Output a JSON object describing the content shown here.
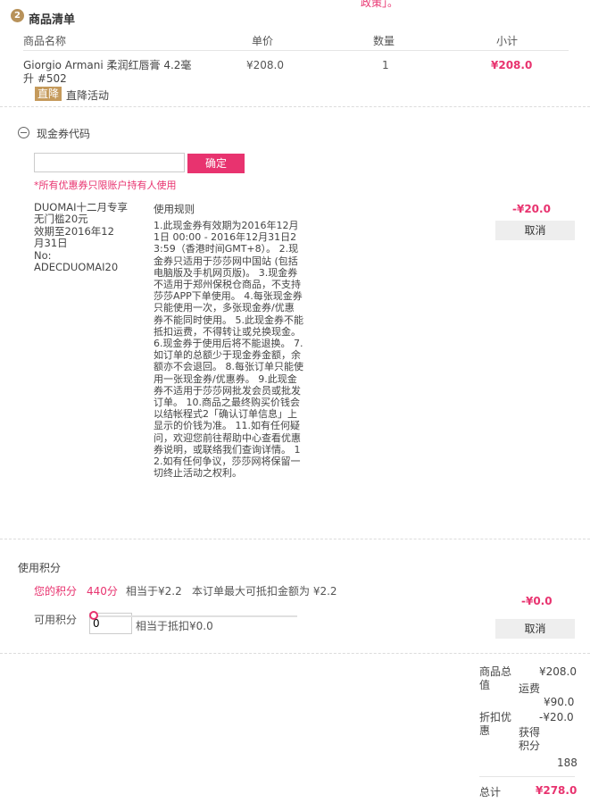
{
  "top_link": "政策」。",
  "section": {
    "step": "2",
    "title": "商品清单"
  },
  "table": {
    "headers": [
      "商品名称",
      "单价",
      "数量",
      "小计"
    ],
    "item": {
      "name": "Giorgio Armani 柔润红唇膏 4.2毫升 #502",
      "price": "¥208.0",
      "qty": "1",
      "subtotal": "¥208.0",
      "promo_tag": "直降",
      "promo_text": "直降活动"
    }
  },
  "coupon": {
    "title": "现金券代码",
    "input_value": "",
    "confirm_label": "确定",
    "warning": "*所有优惠券只限账户持有人使用",
    "name": "DUOMAI十二月专享 无门槛20元",
    "validity": "效期至2016年12月31日",
    "no_label": "No:",
    "code": "ADECDUOMAI20",
    "rules_title": "使用规则",
    "rules_text": "1.此现金券有效期为2016年12月1日 00:00 - 2016年12月31日23:59（香港时间GMT+8）。 2.现金券只适用于莎莎网中国站 (包括电脑版及手机网页版)。 3.现金券不适用于郑州保税仓商品，不支持莎莎APP下单使用。 4.每张现金券只能使用一次，多张现金券/优惠券不能同时使用。 5.此现金券不能抵扣运费，不得转让或兑换现金。 6.现金券于使用后将不能退换。 7.如订单的总额少于现金券金额，余额亦不会退回。 8.每张订单只能使用一张现金券/优惠券。 9.此现金券不适用于莎莎网批发会员或批发订单。 10.商品之最终购买价钱会以结帐程式2「确认订单信息」上显示的价钱为准。 11.如有任何疑问，欢迎您前往帮助中心查看优惠券说明，或联络我们查询详情。 12.如有任何争议，莎莎网将保留一切终止活动之权利。",
    "discount": "-¥20.0",
    "cancel_label": "取消"
  },
  "points": {
    "title": "使用积分",
    "your_points_label": "您的积分",
    "your_points_value": "440分",
    "equivalent": "相当于¥2.2",
    "max_deduct": "本订单最大可抵扣金额为 ¥2.2",
    "usable_label": "可用积分",
    "input_value": "0",
    "slider_fraction": 0,
    "deduct_text": "相当于抵扣¥0.0",
    "discount": "-¥0.0",
    "cancel_label": "取消"
  },
  "summary": {
    "goods_total_label": "商品总值",
    "goods_total": "¥208.0",
    "shipping_label": "运费",
    "shipping": "¥90.0",
    "discount_label": "折扣优惠",
    "discount": "-¥20.0",
    "points_label": "获得积分",
    "points": "188",
    "total_label": "总计",
    "total": "¥278.0"
  },
  "colors": {
    "accent": "#e8336f",
    "tag": "#c59a5b"
  }
}
